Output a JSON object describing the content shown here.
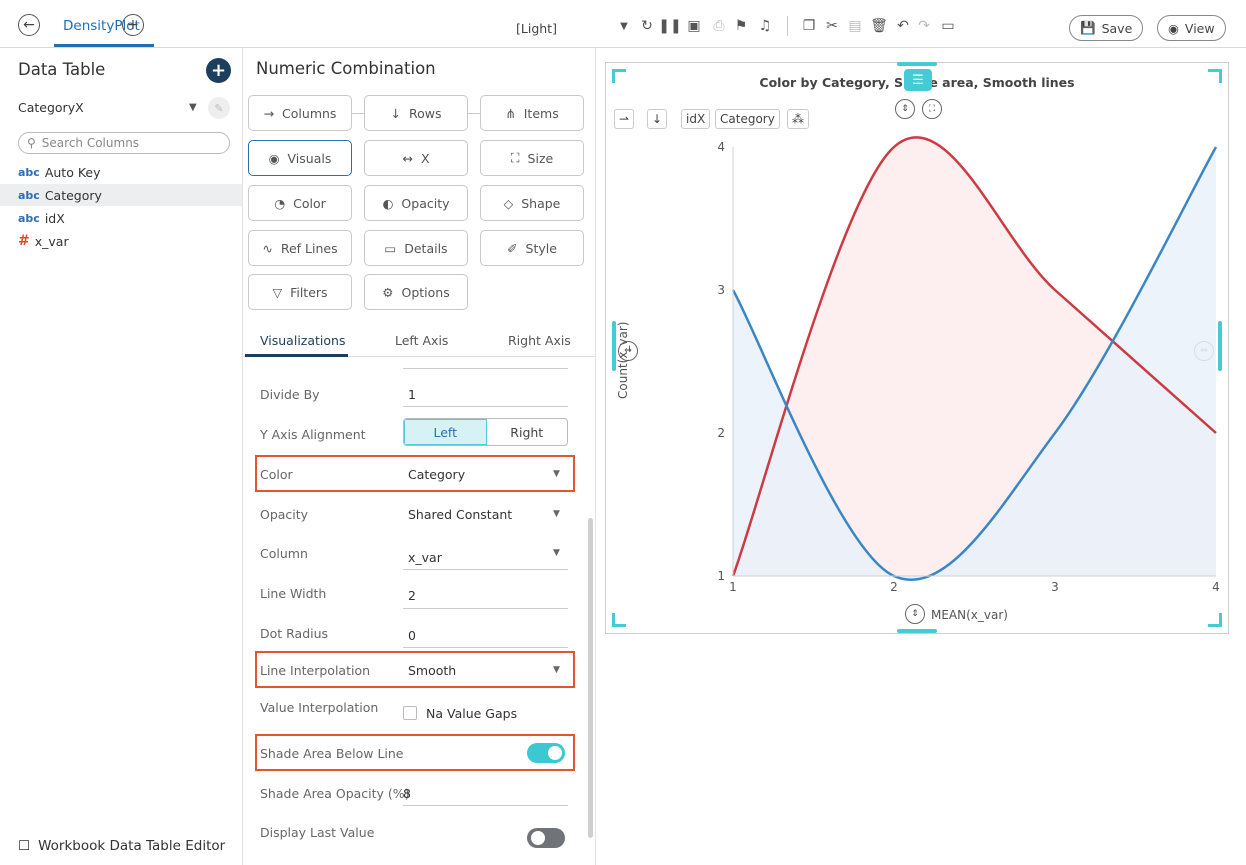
{
  "topbar": {
    "tab_title": "DensityPlot",
    "theme": "[Light]",
    "save_label": "Save",
    "view_label": "View"
  },
  "data_table": {
    "title": "Data Table",
    "table_name": "CategoryX",
    "search_placeholder": "Search Columns",
    "columns": [
      {
        "type": "abc",
        "name": "Auto Key"
      },
      {
        "type": "abc",
        "name": "Category"
      },
      {
        "type": "abc",
        "name": "idX"
      },
      {
        "type": "#",
        "name": "x_var"
      }
    ],
    "footer": "Workbook Data Table Editor"
  },
  "settings": {
    "title": "Numeric Combination",
    "buttons": [
      "Columns",
      "Rows",
      "Items",
      "Visuals",
      "X",
      "Size",
      "Color",
      "Opacity",
      "Shape",
      "Ref Lines",
      "Details",
      "Style",
      "Filters",
      "Options"
    ],
    "tabs": [
      "Visualizations",
      "Left Axis",
      "Right Axis"
    ],
    "props": {
      "divide_by_label": "Divide By",
      "divide_by": "1",
      "y_axis_label": "Y Axis Alignment",
      "y_left": "Left",
      "y_right": "Right",
      "color_label": "Color",
      "color": "Category",
      "opacity_label": "Opacity",
      "opacity": "Shared Constant",
      "column_label": "Column",
      "column": "x_var",
      "line_width_label": "Line Width",
      "line_width": "2",
      "dot_radius_label": "Dot Radius",
      "dot_radius": "0",
      "interp_label": "Line Interpolation",
      "interp": "Smooth",
      "value_interp_label": "Value Interpolation",
      "na_gaps": "Na Value Gaps",
      "shade_label": "Shade Area Below Line",
      "shade_on": true,
      "shade_opacity_label": "Shade Area Opacity (%)",
      "shade_opacity": "8",
      "last_value_label": "Display Last Value",
      "last_value_on": false
    }
  },
  "chart": {
    "title": "Color by Category, Shade area, Smooth lines",
    "chips": [
      "idX",
      "Category"
    ],
    "x_label": "MEAN(x_var)",
    "y_label": "Count(x_var)"
  },
  "chart_data": {
    "type": "area",
    "title": "Color by Category, Shade area, Smooth lines",
    "xlabel": "MEAN(x_var)",
    "ylabel": "Count(x_var)",
    "xlim": [
      1,
      4
    ],
    "ylim": [
      1,
      4
    ],
    "x_ticks": [
      1,
      2,
      3,
      4
    ],
    "y_ticks": [
      1,
      2,
      3,
      4
    ],
    "grid": false,
    "smooth": true,
    "series": [
      {
        "color": "#cc3b43",
        "fill": "#fdecec",
        "x": [
          1,
          2,
          3,
          4
        ],
        "y": [
          1,
          4,
          3,
          2
        ]
      },
      {
        "color": "#3a87c4",
        "fill": "#e9f1fa",
        "x": [
          1,
          2,
          3,
          4
        ],
        "y": [
          3,
          1,
          2,
          4
        ]
      }
    ]
  },
  "colors": {
    "accent": "#45cbd3",
    "highlight": "#e2552f",
    "brand": "#1f6fb5"
  }
}
